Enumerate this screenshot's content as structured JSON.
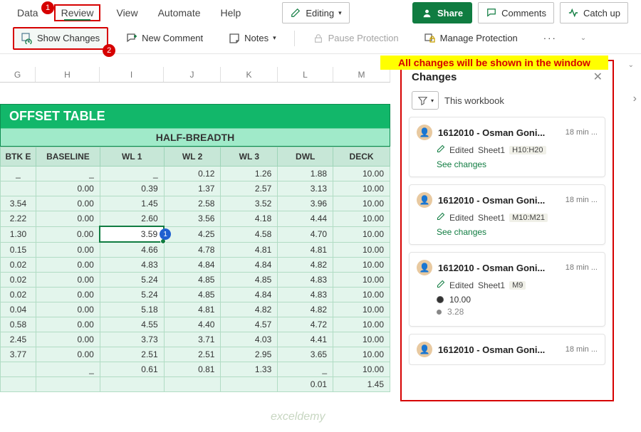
{
  "tabs": {
    "data": "Data",
    "review": "Review",
    "view": "View",
    "automate": "Automate",
    "help": "Help"
  },
  "badges": {
    "b1": "1",
    "b2": "2",
    "b3": "1"
  },
  "ribbon": {
    "editing": "Editing",
    "show_changes": "Show Changes",
    "new_comment": "New Comment",
    "notes": "Notes",
    "pause": "Pause Protection",
    "manage": "Manage Protection",
    "share": "Share",
    "comments": "Comments",
    "catchup": "Catch up",
    "more": "···"
  },
  "annotation": "All changes will be shown in the window",
  "cols": [
    "G",
    "H",
    "I",
    "J",
    "K",
    "L",
    "M"
  ],
  "sheet": {
    "title": "OFFSET TABLE",
    "subtitle": "HALF-BREADTH",
    "headers": [
      "BTK E",
      "BASELINE",
      "WL 1",
      "WL 2",
      "WL 3",
      "DWL",
      "DECK"
    ],
    "rows": [
      [
        "_",
        "_",
        "_",
        "0.12",
        "1.26",
        "1.88",
        "10.00"
      ],
      [
        "",
        "0.00",
        "0.39",
        "1.37",
        "2.57",
        "3.13",
        "10.00"
      ],
      [
        "3.54",
        "0.00",
        "1.45",
        "2.58",
        "3.52",
        "3.96",
        "10.00"
      ],
      [
        "2.22",
        "0.00",
        "2.60",
        "3.56",
        "4.18",
        "4.44",
        "10.00"
      ],
      [
        "1.30",
        "0.00",
        "3.59",
        "4.25",
        "4.58",
        "4.70",
        "10.00"
      ],
      [
        "0.15",
        "0.00",
        "4.66",
        "4.78",
        "4.81",
        "4.81",
        "10.00"
      ],
      [
        "0.02",
        "0.00",
        "4.83",
        "4.84",
        "4.84",
        "4.82",
        "10.00"
      ],
      [
        "0.02",
        "0.00",
        "5.24",
        "4.85",
        "4.85",
        "4.83",
        "10.00"
      ],
      [
        "0.02",
        "0.00",
        "5.24",
        "4.85",
        "4.84",
        "4.83",
        "10.00"
      ],
      [
        "0.04",
        "0.00",
        "5.18",
        "4.81",
        "4.82",
        "4.82",
        "10.00"
      ],
      [
        "0.58",
        "0.00",
        "4.55",
        "4.40",
        "4.57",
        "4.72",
        "10.00"
      ],
      [
        "2.45",
        "0.00",
        "3.73",
        "3.71",
        "4.03",
        "4.41",
        "10.00"
      ],
      [
        "3.77",
        "0.00",
        "2.51",
        "2.51",
        "2.95",
        "3.65",
        "10.00"
      ],
      [
        "",
        "_",
        "0.61",
        "0.81",
        "1.33",
        "_",
        "10.00"
      ],
      [
        "",
        "",
        "",
        "",
        "",
        "0.01",
        "1.45"
      ]
    ]
  },
  "panel": {
    "title": "Changes",
    "scope": "This workbook",
    "cards": [
      {
        "user": "1612010 - Osman Goni...",
        "time": "18 min ...",
        "action": "Edited",
        "sheet": "Sheet1",
        "range": "H10:H20",
        "link": "See changes"
      },
      {
        "user": "1612010 - Osman Goni...",
        "time": "18 min ...",
        "action": "Edited",
        "sheet": "Sheet1",
        "range": "M10:M21",
        "link": "See changes"
      },
      {
        "user": "1612010 - Osman Goni...",
        "time": "18 min ...",
        "action": "Edited",
        "sheet": "Sheet1",
        "range": "M9",
        "v1": "10.00",
        "v2": "3.28"
      },
      {
        "user": "1612010 - Osman Goni...",
        "time": "18 min ..."
      }
    ]
  },
  "watermark": "exceldemy"
}
